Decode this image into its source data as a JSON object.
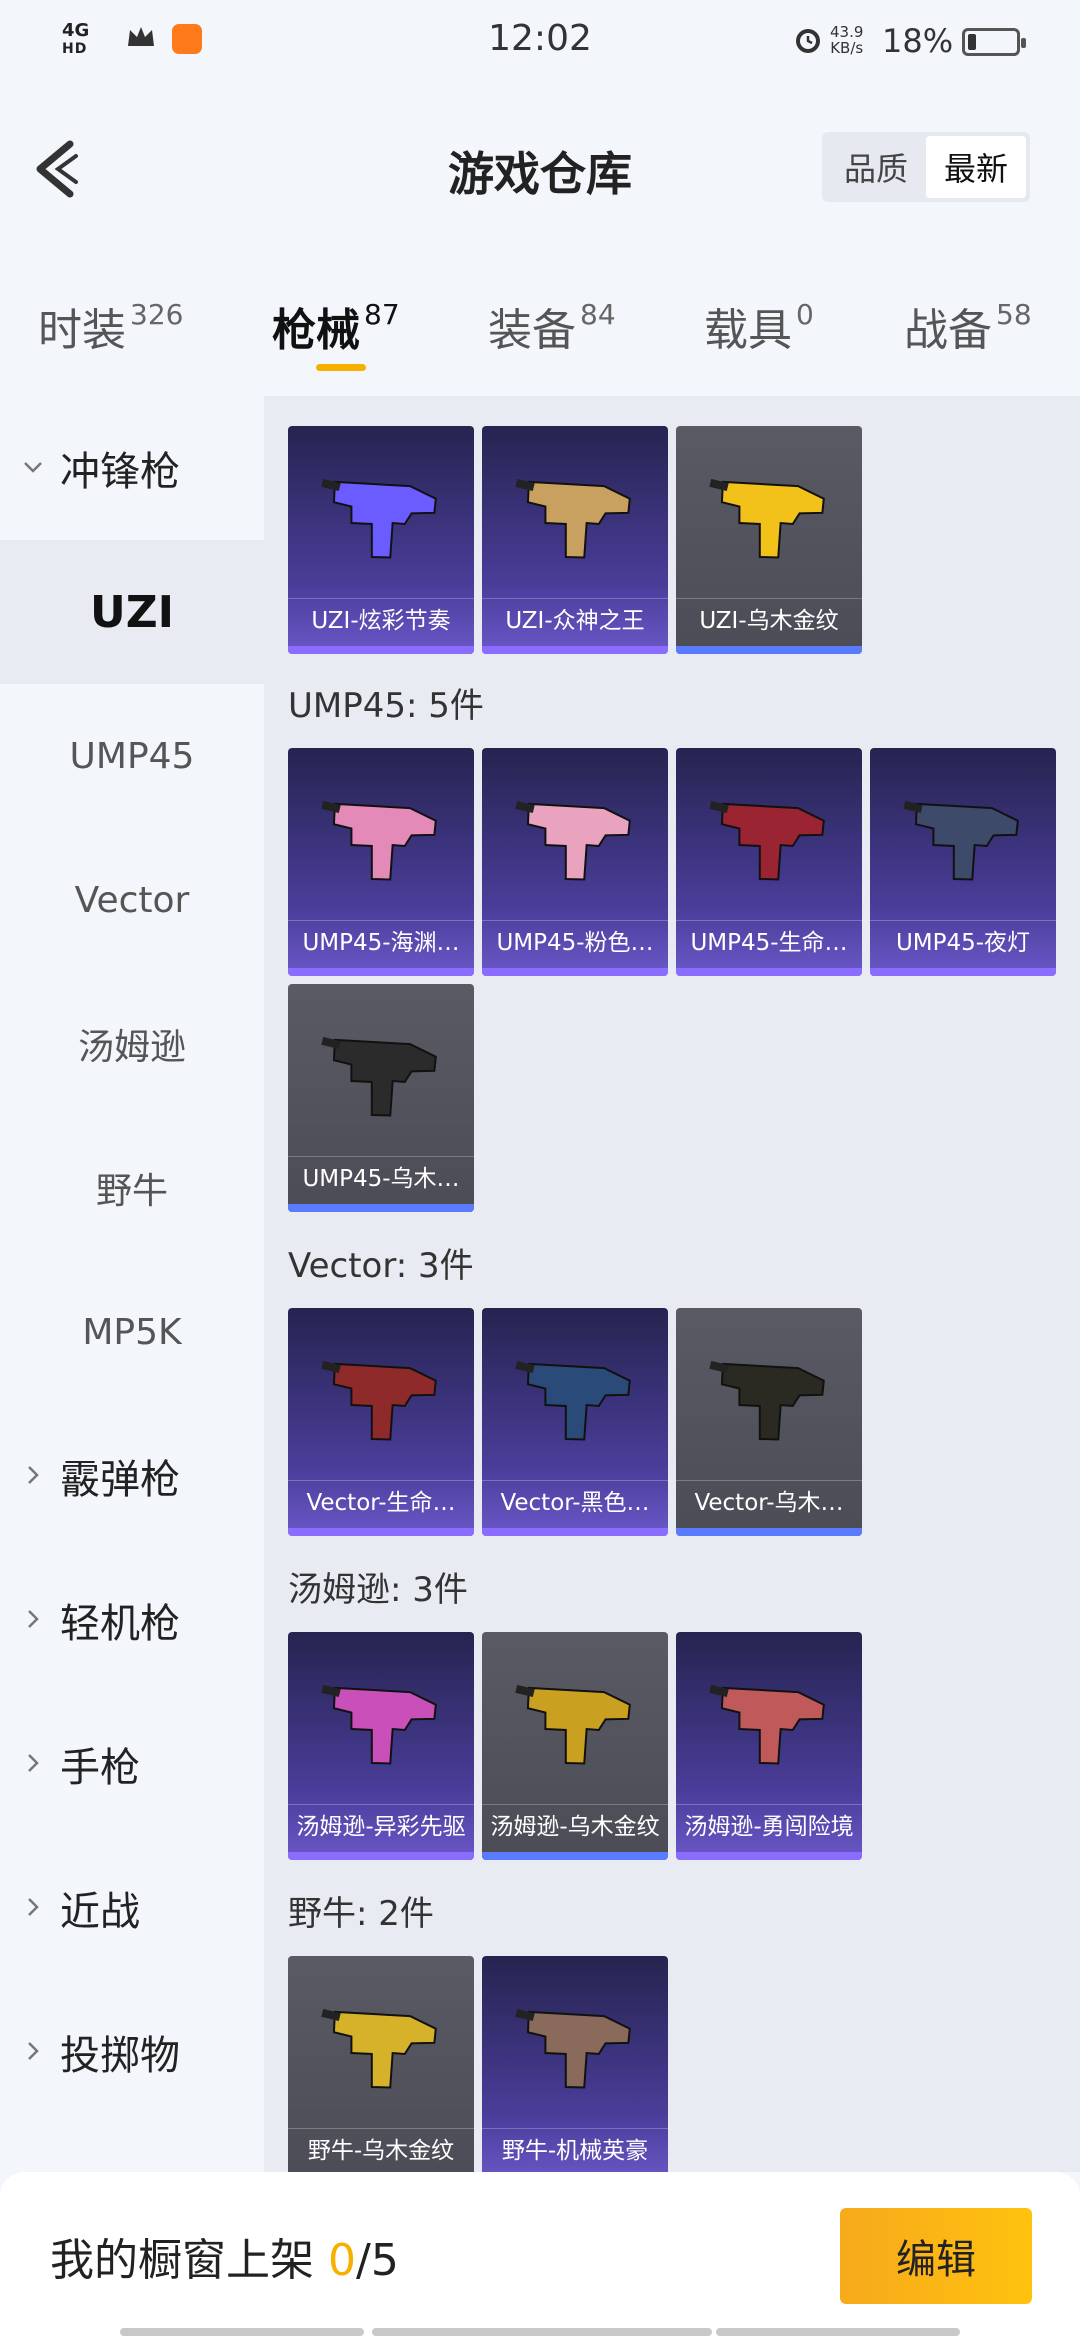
{
  "status_bar": {
    "network": "4G",
    "network_sub": "HD",
    "time": "12:02",
    "speed_value": "43.9",
    "speed_unit": "KB/s",
    "battery": "18%"
  },
  "header": {
    "title": "游戏仓库",
    "sort_options": [
      "品质",
      "最新"
    ],
    "sort_active": "最新"
  },
  "tabs": [
    {
      "label": "时装",
      "count": "326"
    },
    {
      "label": "枪械",
      "count": "87"
    },
    {
      "label": "装备",
      "count": "84"
    },
    {
      "label": "载具",
      "count": "0"
    },
    {
      "label": "战备",
      "count": "58"
    }
  ],
  "sidebar": {
    "groups": [
      {
        "label": "冲锋枪",
        "expanded": true,
        "items": [
          "UZI",
          "UMP45",
          "Vector",
          "汤姆逊",
          "野牛",
          "MP5K"
        ],
        "selected": "UZI"
      },
      {
        "label": "霰弹枪"
      },
      {
        "label": "轻机枪"
      },
      {
        "label": "手枪"
      },
      {
        "label": "近战"
      },
      {
        "label": "投掷物"
      }
    ]
  },
  "sections": [
    {
      "title": "",
      "items": [
        {
          "name": "UZI-炫彩节奏",
          "quality": "purple",
          "color": "#6a5cff"
        },
        {
          "name": "UZI-众神之王",
          "quality": "purple",
          "color": "#c8a060"
        },
        {
          "name": "UZI-乌木金纹",
          "quality": "gray",
          "color": "#f2c21a"
        }
      ]
    },
    {
      "title": "UMP45: 5件",
      "items": [
        {
          "name": "UMP45-海渊…",
          "quality": "purple",
          "color": "#e48ab8"
        },
        {
          "name": "UMP45-粉色…",
          "quality": "purple",
          "color": "#e9a3bf"
        },
        {
          "name": "UMP45-生命…",
          "quality": "purple",
          "color": "#9a2432"
        },
        {
          "name": "UMP45-夜灯",
          "quality": "purple",
          "color": "#3e4a6a"
        },
        {
          "name": "UMP45-乌木…",
          "quality": "gray",
          "color": "#2b2b2b"
        }
      ]
    },
    {
      "title": "Vector: 3件",
      "items": [
        {
          "name": "Vector-生命…",
          "quality": "purple",
          "color": "#8f2a2a"
        },
        {
          "name": "Vector-黑色…",
          "quality": "purple",
          "color": "#2a4b7a"
        },
        {
          "name": "Vector-乌木…",
          "quality": "gray",
          "color": "#2a2a22"
        }
      ]
    },
    {
      "title": "汤姆逊: 3件",
      "items": [
        {
          "name": "汤姆逊-异彩先驱",
          "quality": "purple",
          "color": "#c850b8"
        },
        {
          "name": "汤姆逊-乌木金纹",
          "quality": "gray",
          "color": "#c9a020"
        },
        {
          "name": "汤姆逊-勇闯险境",
          "quality": "purple",
          "color": "#c05a5a"
        }
      ]
    },
    {
      "title": "野牛: 2件",
      "items": [
        {
          "name": "野牛-乌木金纹",
          "quality": "gray",
          "color": "#d6b22a"
        },
        {
          "name": "野牛-机械英豪",
          "quality": "purple",
          "color": "#8a6a5a"
        }
      ]
    }
  ],
  "bottom": {
    "label": "我的橱窗上架",
    "current": "0",
    "total": "/5",
    "edit_button": "编辑"
  }
}
